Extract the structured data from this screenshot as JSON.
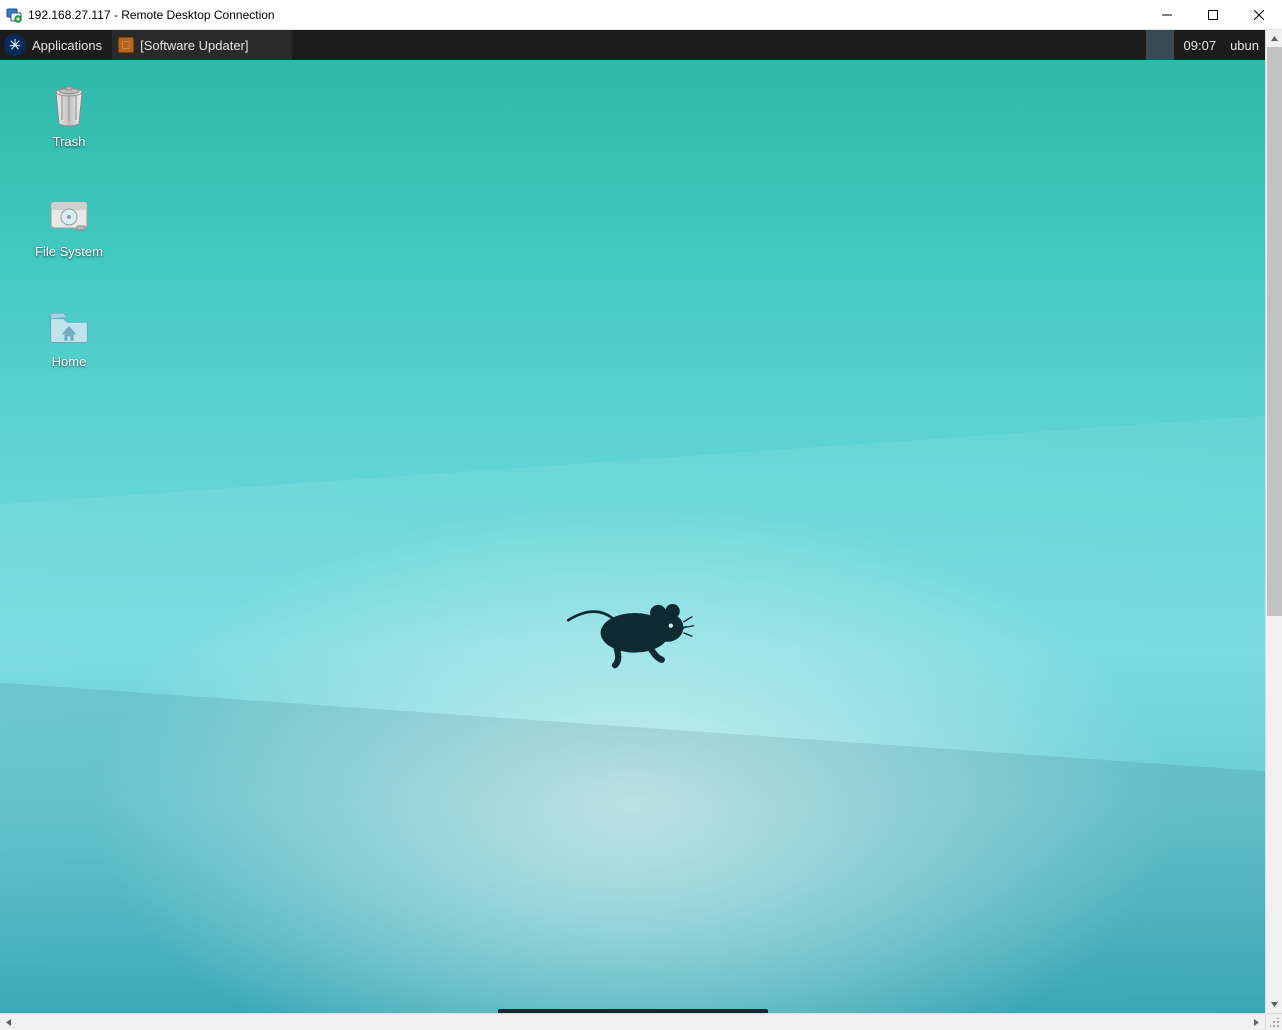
{
  "window": {
    "title": "192.168.27.117 - Remote Desktop Connection"
  },
  "remote": {
    "panel": {
      "applications_label": "Applications",
      "task_button_label": "[Software Updater]",
      "clock": "09:07",
      "username": "ubun"
    },
    "desktop_icons": {
      "trash": "Trash",
      "filesystem": "File System",
      "home": "Home"
    }
  }
}
